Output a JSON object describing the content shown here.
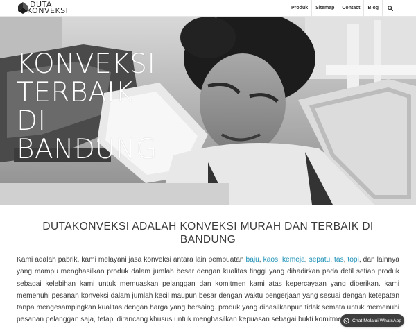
{
  "brand": {
    "line1": "DUTA",
    "line2": "KONVEKSI"
  },
  "nav": {
    "items": [
      {
        "label": "Produk"
      },
      {
        "label": "Sitemap"
      },
      {
        "label": "Contact"
      },
      {
        "label": "Blog"
      }
    ],
    "search_icon": "search-icon"
  },
  "hero": {
    "title_lines": [
      "KONVEKSI",
      "TERBAIK",
      "DI",
      "BANDUNG"
    ]
  },
  "main": {
    "headline": "DUTAKONVEKSI ADALAH KONVEKSI MURAH DAN TERBAIK DI BANDUNG",
    "intro": "Kami adalah pabrik, kami melayani jasa konveksi antara lain pembuatan",
    "links": [
      "baju",
      "kaos",
      "kemeja",
      "sepatu",
      "tas",
      "topi"
    ],
    "body_after_links": ", dan lainnya yang mampu menghasilkan produk dalam jumlah besar dengan kualitas tinggi yang dihadirkan pada detil setiap produk sebagai kelebihan kami untuk memuaskan pelanggan dan komitmen kami atas kepercayaan yang diberikan. kami memenuhi pesanan konveksi dalam jumlah kecil maupun besar dengan waktu pengerjaan yang sesuai dengan ketepatan tanpa mengesampingkan kualitas dengan harga yang bersaing. produk yang dihasilkanpun tidak semata untuk memenuhi pesanan pelanggan saja, tetapi dirancang khusus untuk menghasilkan kepuasan sebagai bukti komitmen ka"
  },
  "whatsapp": {
    "label": "Chat Melalui WhatsApp",
    "icon": "whatsapp-icon",
    "color": "#3e3e3e"
  },
  "colors": {
    "link": "#1a8fb5",
    "text": "#3a3a3a"
  }
}
